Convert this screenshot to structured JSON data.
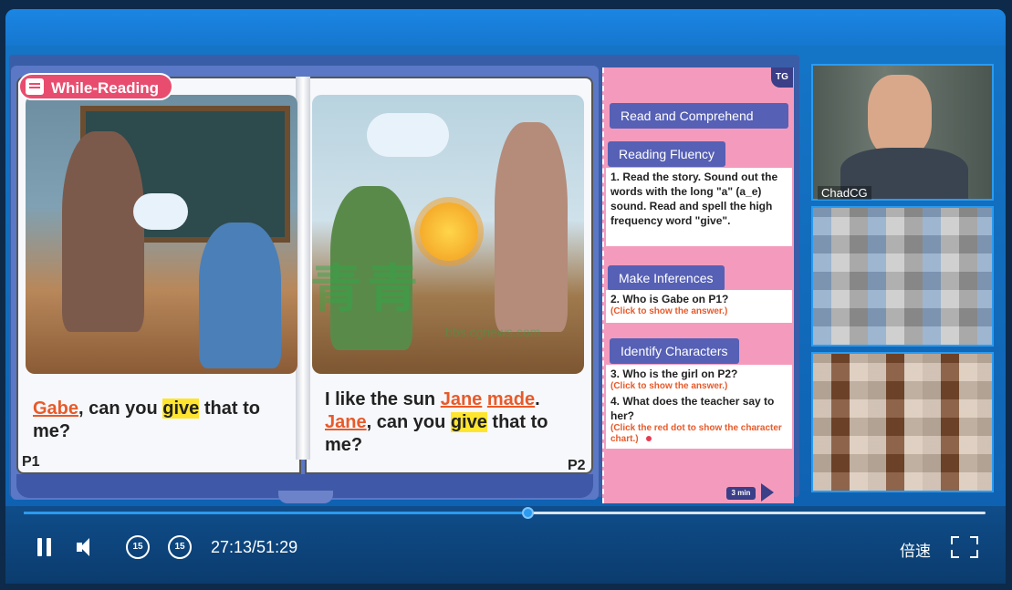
{
  "lesson": {
    "badge": "While-Reading",
    "page1": {
      "parts": [
        {
          "text": "Gabe",
          "style": "red"
        },
        {
          "text": ", can you ",
          "style": "plain"
        },
        {
          "text": "give",
          "style": "hl"
        },
        {
          "text": " that to me?",
          "style": "plain"
        }
      ],
      "number": "P1"
    },
    "page2": {
      "parts": [
        {
          "text": "I like the sun ",
          "style": "plain"
        },
        {
          "text": "Jane",
          "style": "red"
        },
        {
          "text": " ",
          "style": "plain"
        },
        {
          "text": "made",
          "style": "red"
        },
        {
          "text": ". ",
          "style": "plain"
        },
        {
          "text": "Jane",
          "style": "red"
        },
        {
          "text": ", can you ",
          "style": "plain"
        },
        {
          "text": "give",
          "style": "hl"
        },
        {
          "text": " that to me?",
          "style": "plain"
        }
      ],
      "number": "P2"
    },
    "watermark": "青青",
    "watermark_sub": "bbs.cgnews.com"
  },
  "sidebar": {
    "tag": "TG",
    "read_comprehend": "Read and Comprehend",
    "reading_fluency": "Reading Fluency",
    "fluency_text": "1. Read the story. Sound out the words with the long \"a\" (a_e) sound. Read and spell the high frequency word \"give\".",
    "make_inferences": "Make Inferences",
    "q2": "2. Who is Gabe on P1?",
    "q2_hint": "(Click to show the answer.)",
    "identify_characters": "Identify Characters",
    "q3": "3. Who is the girl on P2?",
    "q3_hint": "(Click to show the answer.)",
    "q4": "4. What does the teacher say to her?",
    "q4_hint": "(Click the red dot to show the character chart.)",
    "timer": "3 min"
  },
  "cameras": {
    "teacher_name": "ChadCG"
  },
  "player": {
    "time": "27:13/51:29",
    "speed": "倍速",
    "skip_back": "15",
    "skip_fwd": "15",
    "progress": 0.525
  },
  "colors": {
    "accent": "#2b9bf0",
    "highlight": "#ffe52e",
    "red_word": "#e85a2a",
    "sidebar_bg": "#f49bbd",
    "sidebar_button": "#5660b5"
  }
}
